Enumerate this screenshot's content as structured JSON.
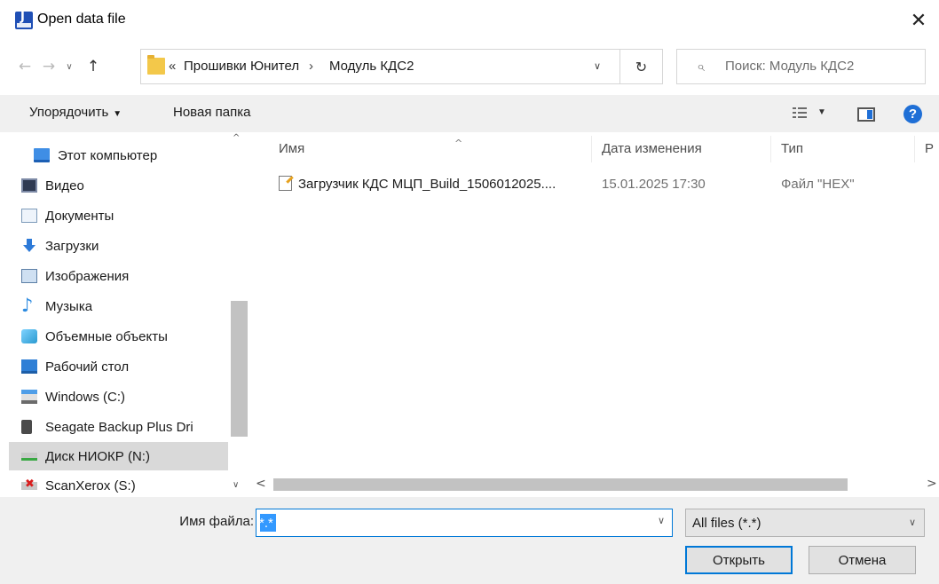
{
  "window": {
    "title": "Open data file",
    "close_glyph": "✕"
  },
  "nav": {
    "back_glyph": "←",
    "forward_glyph": "→",
    "recent_glyph": "∨",
    "up_glyph": "↑"
  },
  "address": {
    "overflow_glyph": "«",
    "crumbs": [
      "Прошивки Юнител",
      "Модуль КДС2"
    ],
    "separator": "›",
    "dropdown_glyph": "∨",
    "refresh_glyph": "↻"
  },
  "search": {
    "placeholder": "Поиск: Модуль КДС2",
    "icon_glyph": "⌕"
  },
  "toolbar": {
    "organize_label": "Упорядочить",
    "organize_caret": "▼",
    "new_folder_label": "Новая папка",
    "view_caret": "▼",
    "help_glyph": "?"
  },
  "tree": {
    "items": [
      {
        "label": "Этот компьютер",
        "icon": "computer-icon"
      },
      {
        "label": "Видео",
        "icon": "video-folder-icon"
      },
      {
        "label": "Документы",
        "icon": "documents-folder-icon"
      },
      {
        "label": "Загрузки",
        "icon": "downloads-folder-icon"
      },
      {
        "label": "Изображения",
        "icon": "pictures-folder-icon"
      },
      {
        "label": "Музыка",
        "icon": "music-folder-icon"
      },
      {
        "label": "Объемные объекты",
        "icon": "3d-objects-icon"
      },
      {
        "label": "Рабочий стол",
        "icon": "desktop-folder-icon"
      },
      {
        "label": "Windows (C:)",
        "icon": "local-drive-icon"
      },
      {
        "label": "Seagate Backup Plus Dri",
        "icon": "usb-drive-icon"
      },
      {
        "label": "Диск НИОКР (N:)",
        "icon": "network-drive-icon"
      },
      {
        "label": "ScanXerox (S:)",
        "icon": "disconnected-network-drive-icon"
      }
    ],
    "selected_index": 10,
    "scroll_up_glyph": "^",
    "scroll_down_glyph": "∨"
  },
  "files": {
    "columns": [
      "Имя",
      "Дата изменения",
      "Тип",
      "Р"
    ],
    "sort_glyph": "^",
    "rows": [
      {
        "name": "Загрузчик КДС МЦП_Build_1506012025....",
        "date": "15.01.2025 17:30",
        "type": "Файл \"HEX\"",
        "icon": "hex-file-icon"
      }
    ],
    "hscroll_left_glyph": "<",
    "hscroll_right_glyph": ">"
  },
  "bottom": {
    "filename_label": "Имя файла:",
    "filename_value": "*.*",
    "filename_caret": "∨",
    "filter_value": "All files (*.*)",
    "filter_caret": "∨",
    "open_label": "Открыть",
    "cancel_label": "Отмена"
  },
  "colors": {
    "accent": "#0078d7",
    "toolbar_bg": "#f0f0f0",
    "selected_bg": "#d9d9d9"
  }
}
